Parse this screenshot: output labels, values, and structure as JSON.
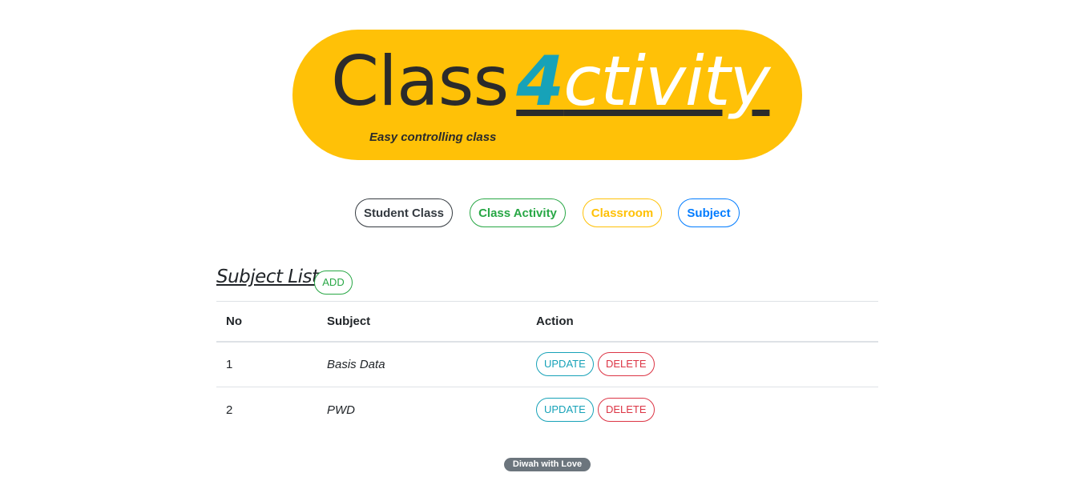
{
  "logo": {
    "word_class": "Class",
    "activity_first": "4",
    "activity_rest": "ctivity",
    "tagline": "Easy controlling class"
  },
  "nav": {
    "items": [
      {
        "label": "Student Class",
        "color": "#343a40"
      },
      {
        "label": "Class Activity",
        "color": "#28a745"
      },
      {
        "label": "Classroom",
        "color": "#ffc107"
      },
      {
        "label": "Subject",
        "color": "#007bff"
      }
    ]
  },
  "section": {
    "title": "Subject List",
    "add_label": "ADD"
  },
  "table": {
    "headers": [
      "No",
      "Subject",
      "Action"
    ],
    "rows": [
      {
        "no": "1",
        "subject": "Basis Data",
        "update_label": "UPDATE",
        "delete_label": "DELETE"
      },
      {
        "no": "2",
        "subject": "PWD",
        "update_label": "UPDATE",
        "delete_label": "DELETE"
      }
    ]
  },
  "footer": {
    "badge": "Diwah with Love"
  },
  "colors": {
    "brand_yellow": "#ffc107",
    "accent_teal": "#17a2b8",
    "danger": "#dc3545",
    "success": "#28a745",
    "primary": "#007bff"
  }
}
